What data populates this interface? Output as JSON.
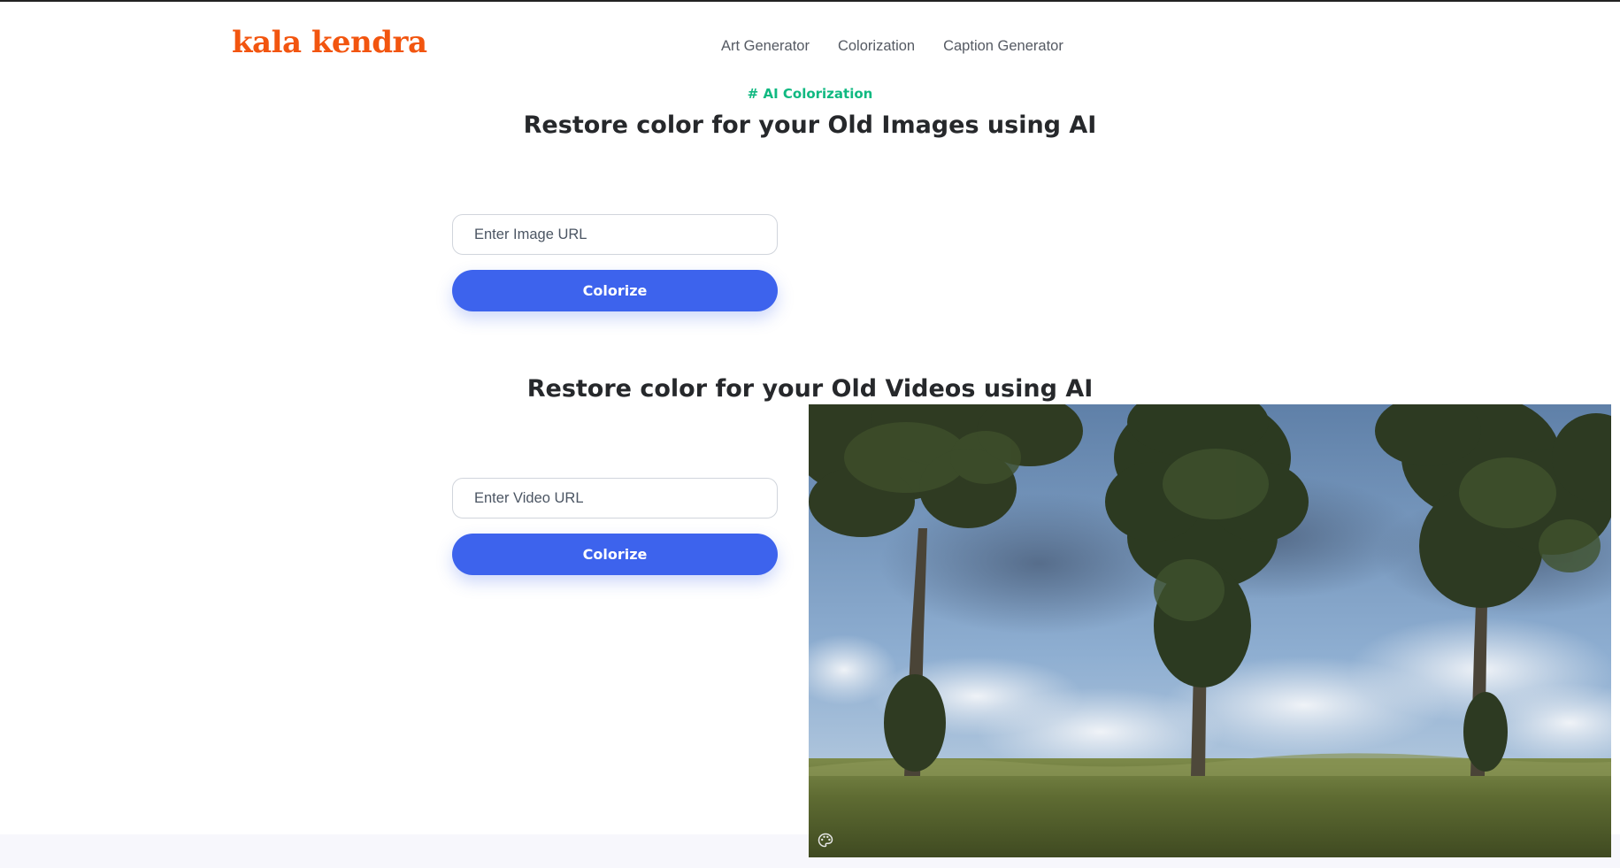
{
  "brand": {
    "logo_text": "kala kendra",
    "logo_color": "#f2550f"
  },
  "nav": {
    "items": [
      {
        "label": "Art Generator"
      },
      {
        "label": "Colorization"
      },
      {
        "label": "Caption Generator"
      }
    ]
  },
  "colors": {
    "accent_green": "#10b981",
    "button_blue": "#3d63ed",
    "heading": "#26282b"
  },
  "image_section": {
    "tag": "# AI Colorization",
    "title": "Restore color for your Old Images using AI",
    "input_placeholder": "Enter Image URL",
    "button_label": "Colorize"
  },
  "video_section": {
    "title": "Restore color for your Old Videos using AI",
    "input_placeholder": "Enter Video URL",
    "button_label": "Colorize"
  },
  "video_preview": {
    "icon": "palette-icon"
  }
}
